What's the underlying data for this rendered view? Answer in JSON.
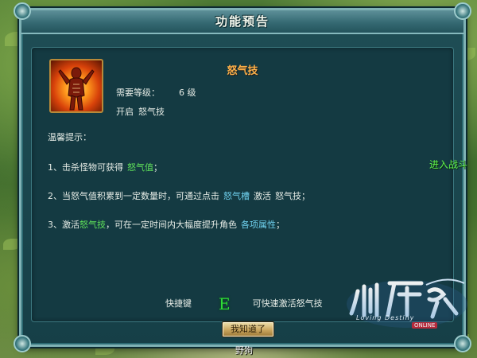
{
  "window": {
    "title": "功能预告"
  },
  "skill": {
    "name": "怒气技",
    "requirement_label": "需要等级：",
    "requirement_level": "6",
    "level_unit": "级",
    "unlock_prefix": "开启",
    "unlock_name": "怒气技"
  },
  "tips": {
    "header": "温馨提示：",
    "items": [
      {
        "prefix": "1、击杀怪物可获得",
        "highlight": "怒气值",
        "suffix": "；"
      },
      {
        "prefix": "2、当怒气值积累到一定数量时，可通过点击",
        "highlight": "怒气槽",
        "middle": "激活",
        "tail": "怒气技；"
      },
      {
        "prefix": "3、激活",
        "highlight": "怒气技",
        "middle": "，可在一定时间内大幅度提升角色",
        "highlight2": "各项属性",
        "suffix": "；"
      }
    ]
  },
  "hotkey": {
    "label": "快捷键",
    "key": "E",
    "description": "可快速激活怒气技"
  },
  "buttons": {
    "ok": "我知道了"
  },
  "world": {
    "side_text": "进入战斗",
    "monster_name": "野狗"
  },
  "logo": {
    "chinese": "仙府之缘",
    "english": "Loving Destiny",
    "tag": "ONLINE"
  },
  "colors": {
    "skill_name": "#ffb24a",
    "highlight_green": "#5fe05a",
    "highlight_blue": "#6fd1ee",
    "hotkey": "#2ede37"
  },
  "icons": {
    "skill_icon": "rage-figure-icon"
  }
}
